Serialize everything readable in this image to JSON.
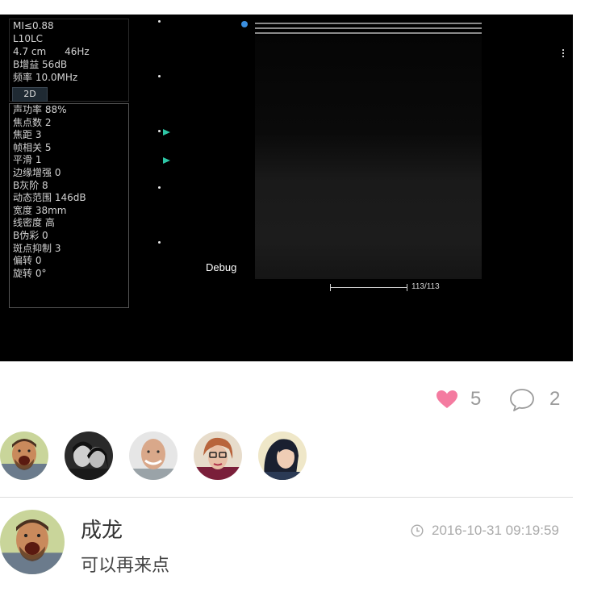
{
  "ultrasound": {
    "params": [
      "MI≤0.88",
      "L10LC",
      "4.7 cm      46Hz",
      "B增益 56dB",
      "频率 10.0MHz"
    ],
    "mode_tab": "2D",
    "settings": [
      "声功率 88%",
      "焦点数 2",
      "焦距 3",
      "帧相关 5",
      "平滑 1",
      "边缘增强 0",
      "B灰阶 8",
      "动态范围 146dB",
      "宽度 38mm",
      "线密度 高",
      "B伪彩 0",
      "斑点抑制 3",
      "偏转 0",
      "旋转 0°"
    ],
    "debug_label": "Debug",
    "frame_counter": "113/113"
  },
  "stats": {
    "likes": "5",
    "comments": "2",
    "like_color": "#f47ba0",
    "icon_color": "#9a9a9a"
  },
  "likers": [
    {
      "name": "avatar-1",
      "icon": "man-laughing"
    },
    {
      "name": "avatar-2",
      "icon": "couple-bw"
    },
    {
      "name": "avatar-3",
      "icon": "bald-man"
    },
    {
      "name": "avatar-4",
      "icon": "woman-glasses"
    },
    {
      "name": "avatar-5",
      "icon": "woman-dark-hair"
    }
  ],
  "comment": {
    "author": "成龙",
    "time": "2016-10-31 09:19:59",
    "text": "可以再来点"
  }
}
